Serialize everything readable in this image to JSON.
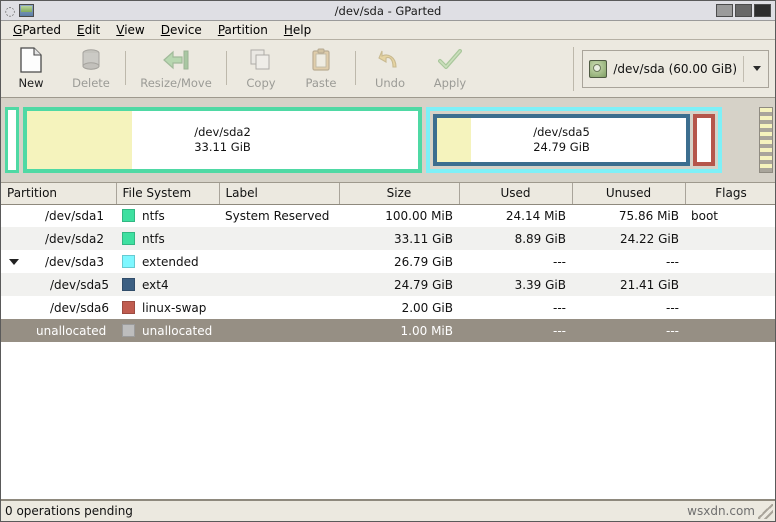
{
  "window": {
    "title": "/dev/sda - GParted",
    "icon": "disk-window-icon",
    "minimize_label": "",
    "maximize_label": "",
    "close_label": ""
  },
  "menubar": {
    "items": [
      {
        "label": "GParted",
        "mnemonic": "G",
        "rest": "Parted"
      },
      {
        "label": "Edit",
        "mnemonic": "E",
        "rest": "dit"
      },
      {
        "label": "View",
        "mnemonic": "V",
        "rest": "iew"
      },
      {
        "label": "Device",
        "mnemonic": "D",
        "rest": "evice"
      },
      {
        "label": "Partition",
        "mnemonic": "P",
        "rest": "artition"
      },
      {
        "label": "Help",
        "mnemonic": "H",
        "rest": "elp"
      }
    ]
  },
  "toolbar": {
    "new_label": "New",
    "delete_label": "Delete",
    "resize_label": "Resize/Move",
    "copy_label": "Copy",
    "paste_label": "Paste",
    "undo_label": "Undo",
    "apply_label": "Apply",
    "device_selector": {
      "value": "/dev/sda  (60.00 GiB)",
      "icon": "hard-disk-icon"
    }
  },
  "graphic": {
    "partitions": [
      {
        "name": "",
        "size": "",
        "kind": "sda1",
        "border_color": "#4fd9a4"
      },
      {
        "name": "/dev/sda2",
        "size": "33.11 GiB",
        "kind": "sda2",
        "border_color": "#4fd9a4",
        "used_percent": 26.8
      },
      {
        "name": "/dev/sda5",
        "size": "24.79 GiB",
        "kind": "sda5",
        "border_color": "#3c6e8f",
        "used_percent": 13.7
      },
      {
        "name": "",
        "size": "",
        "kind": "sda6",
        "border_color": "#b5564b"
      }
    ],
    "extended_border_color": "#7ef0f7"
  },
  "table": {
    "columns": [
      "Partition",
      "File System",
      "Label",
      "Size",
      "Used",
      "Unused",
      "Flags"
    ],
    "rows": [
      {
        "partition": "/dev/sda1",
        "filesystem": "ntfs",
        "fs_color": "#3ee0a0",
        "label": "System Reserved",
        "size": "100.00 MiB",
        "used": "24.14 MiB",
        "unused": "75.86 MiB",
        "flags": "boot",
        "indent": 1,
        "expander": false,
        "selected": false
      },
      {
        "partition": "/dev/sda2",
        "filesystem": "ntfs",
        "fs_color": "#3ee0a0",
        "label": "",
        "size": "33.11 GiB",
        "used": "8.89 GiB",
        "unused": "24.22 GiB",
        "flags": "",
        "indent": 1,
        "expander": false,
        "selected": false
      },
      {
        "partition": "/dev/sda3",
        "filesystem": "extended",
        "fs_color": "#7ef7ff",
        "label": "",
        "size": "26.79 GiB",
        "used": "---",
        "unused": "---",
        "flags": "",
        "indent": 0,
        "expander": true,
        "selected": false
      },
      {
        "partition": "/dev/sda5",
        "filesystem": "ext4",
        "fs_color": "#3c5f82",
        "label": "",
        "size": "24.79 GiB",
        "used": "3.39 GiB",
        "unused": "21.41 GiB",
        "flags": "",
        "indent": 2,
        "expander": false,
        "selected": false
      },
      {
        "partition": "/dev/sda6",
        "filesystem": "linux-swap",
        "fs_color": "#c05c50",
        "label": "",
        "size": "2.00 GiB",
        "used": "---",
        "unused": "---",
        "flags": "",
        "indent": 2,
        "expander": false,
        "selected": false
      },
      {
        "partition": "unallocated",
        "filesystem": "unallocated",
        "fs_color": "#bdbdbd",
        "label": "",
        "size": "1.00 MiB",
        "used": "---",
        "unused": "---",
        "flags": "",
        "indent": 1,
        "expander": false,
        "selected": true
      }
    ]
  },
  "statusbar": {
    "text": "0 operations pending",
    "watermark": "wsxdn.com"
  }
}
